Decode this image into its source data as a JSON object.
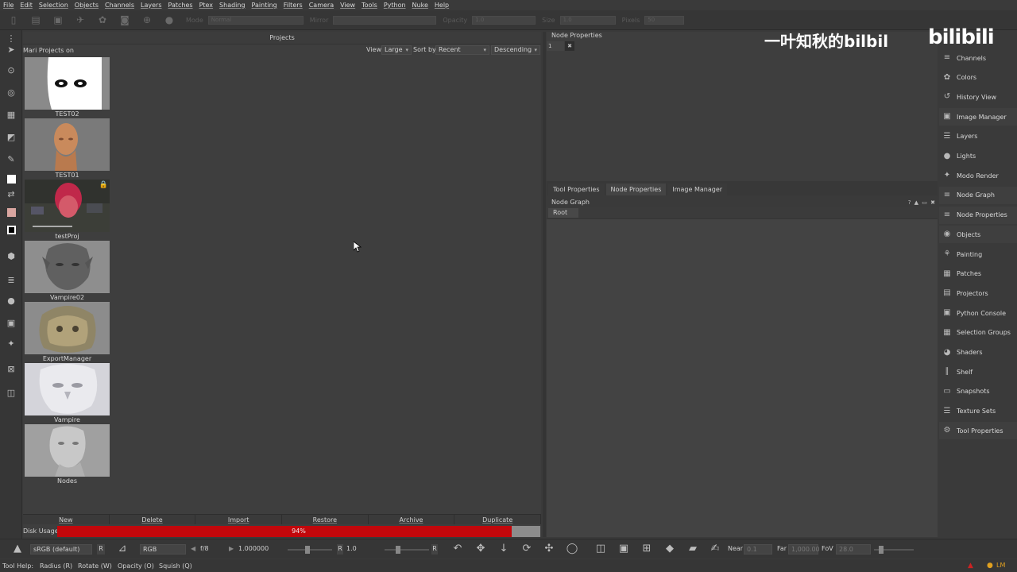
{
  "menu": [
    "File",
    "Edit",
    "Selection",
    "Objects",
    "Channels",
    "Layers",
    "Patches",
    "Ptex",
    "Shading",
    "Painting",
    "Filters",
    "Camera",
    "View",
    "Tools",
    "Python",
    "Nuke",
    "Help"
  ],
  "toolbar": {
    "mode_label": "Mode",
    "mode_value": "Normal",
    "mirror_label": "Mirror",
    "opacity_label": "Opacity",
    "opacity_value": "1.0",
    "size_label": "Size",
    "size_value": "1.0",
    "pixels_label": "Pixels",
    "pixels_value": "50"
  },
  "projects": {
    "title": "Projects",
    "location": "Mari Projects on",
    "view_label": "View",
    "view_value": "Large",
    "sortby_label": "Sort by",
    "sortby_value": "Recent",
    "order_value": "Descending",
    "items": [
      {
        "name": "TEST02"
      },
      {
        "name": "TEST01"
      },
      {
        "name": "testProj"
      },
      {
        "name": "Vampire02"
      },
      {
        "name": "ExportManager"
      },
      {
        "name": "Vampire"
      },
      {
        "name": "Nodes"
      }
    ],
    "buttons": [
      "New",
      "Delete",
      "Import",
      "Restore",
      "Archive",
      "Duplicate"
    ],
    "disk_label": "Disk Usage",
    "disk_percent_text": "94%",
    "disk_fraction": 0.94
  },
  "node_properties": {
    "title": "Node Properties",
    "field_value": "1",
    "btn_label": "✖"
  },
  "mid_tabs": [
    "Tool Properties",
    "Node Properties",
    "Image Manager"
  ],
  "node_graph": {
    "title": "Node Graph",
    "root_label": "Root",
    "icons": "? ▲ ▭ ✖"
  },
  "right_panel": [
    {
      "label": "Channels",
      "icon": "≡"
    },
    {
      "label": "Colors",
      "icon": "✿"
    },
    {
      "label": "History View",
      "icon": "↺"
    },
    {
      "label": "Image Manager",
      "icon": "▣"
    },
    {
      "label": "Layers",
      "icon": "☰"
    },
    {
      "label": "Lights",
      "icon": "●"
    },
    {
      "label": "Modo Render",
      "icon": "✦"
    },
    {
      "label": "Node Graph",
      "icon": "≡"
    },
    {
      "label": "Node Properties",
      "icon": "≡"
    },
    {
      "label": "Objects",
      "icon": "◉"
    },
    {
      "label": "Painting",
      "icon": "⚘"
    },
    {
      "label": "Patches",
      "icon": "▦"
    },
    {
      "label": "Projectors",
      "icon": "▤"
    },
    {
      "label": "Python Console",
      "icon": "▣"
    },
    {
      "label": "Selection Groups",
      "icon": "▦"
    },
    {
      "label": "Shaders",
      "icon": "◕"
    },
    {
      "label": "Shelf",
      "icon": "∥"
    },
    {
      "label": "Snapshots",
      "icon": "▭"
    },
    {
      "label": "Texture Sets",
      "icon": "☰"
    },
    {
      "label": "Tool Properties",
      "icon": "⚙"
    }
  ],
  "watermark": {
    "text": "一叶知秋的bilbil",
    "logo": "bilibili"
  },
  "bottom": {
    "colorspace": "sRGB (default)",
    "r_btn": "R",
    "channel": "RGB",
    "fstop": "f/8",
    "exposure": "1.000000",
    "gain_label": "R",
    "gain_value": "1.0",
    "r2_btn": "R",
    "near_label": "Near",
    "near_value": "0.1",
    "far_label": "Far",
    "far_value": "1,000.00",
    "fov_label": "FoV",
    "fov_value": "28.0"
  },
  "status": {
    "tool_help": "Tool Help:",
    "radius": "Radius (R)",
    "rotate": "Rotate (W)",
    "opacity": "Opacity (O)",
    "squish": "Squish (Q)"
  }
}
